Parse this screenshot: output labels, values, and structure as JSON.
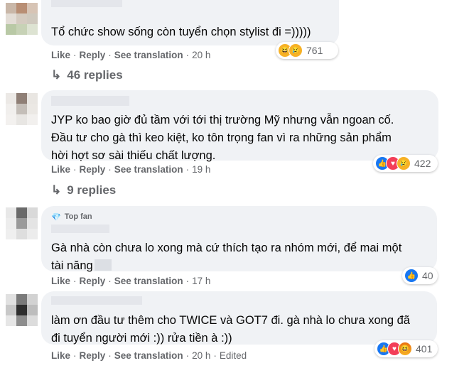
{
  "colors": {
    "bubble_bg": "#f0f2f5",
    "meta_text": "#65676b",
    "like_blue": "#1877f2",
    "love_red": "#f33e58",
    "haha_yellow": "#f7b125"
  },
  "comments": [
    {
      "text": "Tổ chức show sống còn tuyển chọn stylist đi =)))))",
      "actions": {
        "like": "Like",
        "reply": "Reply",
        "translate": "See translation",
        "time": "20 h",
        "edited": ""
      },
      "reactions": {
        "icons": [
          "haha-icon",
          "sad-icon"
        ],
        "count": "761"
      },
      "replies": "46 replies"
    },
    {
      "text_lines": [
        "JYP ko bao giờ đủ tầm với tới thị trường Mỹ nhưng vẫn ngoan cố.",
        "Đầu tư cho gà thì keo kiệt, ko tôn trọng fan vì ra những sản phẩm",
        "hời hợt sơ sài thiếu chất lượng."
      ],
      "actions": {
        "like": "Like",
        "reply": "Reply",
        "translate": "See translation",
        "time": "19 h",
        "edited": ""
      },
      "reactions": {
        "icons": [
          "like-icon",
          "love-icon",
          "sad-icon"
        ],
        "count": "422"
      },
      "replies": "9 replies"
    },
    {
      "badge": "Top fan",
      "text_lines": [
        "Gà nhà còn chưa lo xong mà cứ thích tạo ra nhóm mới, để mai một",
        "tài năng"
      ],
      "actions": {
        "like": "Like",
        "reply": "Reply",
        "translate": "See translation",
        "time": "17 h",
        "edited": ""
      },
      "reactions": {
        "icons": [
          "like-icon"
        ],
        "count": "40"
      }
    },
    {
      "text_lines": [
        "làm ơn đầu tư thêm cho TWICE và GOT7 đi. gà nhà lo chưa xong đã",
        "đi tuyển người mới :)) rửa tiền à :))"
      ],
      "actions": {
        "like": "Like",
        "reply": "Reply",
        "translate": "See translation",
        "time": "20 h",
        "edited": "Edited"
      },
      "reactions": {
        "icons": [
          "like-icon",
          "love-icon",
          "angry-icon"
        ],
        "count": "401"
      }
    }
  ]
}
